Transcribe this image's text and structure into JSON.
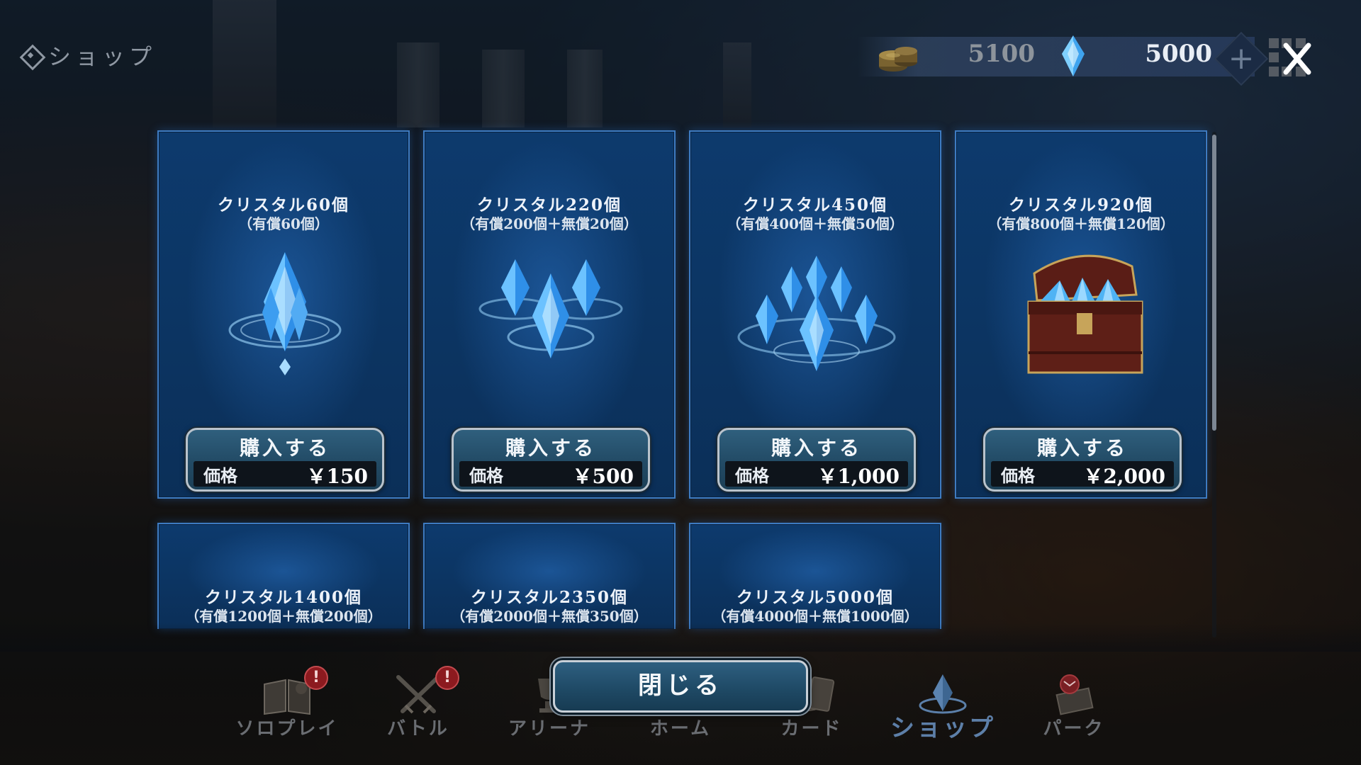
{
  "header": {
    "screen_title": "ショップ",
    "coins": "5100",
    "crystals": "5000",
    "plus_glyph": "+"
  },
  "products": [
    {
      "title": "クリスタル60個",
      "detail": "（有償60個）",
      "buy_label": "購入する",
      "price_label": "価格",
      "price": "￥150",
      "art": "single-crystal"
    },
    {
      "title": "クリスタル220個",
      "detail": "（有償200個＋無償20個）",
      "buy_label": "購入する",
      "price_label": "価格",
      "price": "￥500",
      "art": "three-crystals"
    },
    {
      "title": "クリスタル450個",
      "detail": "（有償400個＋無償50個）",
      "buy_label": "購入する",
      "price_label": "価格",
      "price": "￥1,000",
      "art": "six-crystals"
    },
    {
      "title": "クリスタル920個",
      "detail": "（有償800個＋無償120個）",
      "buy_label": "購入する",
      "price_label": "価格",
      "price": "￥2,000",
      "art": "treasure-chest"
    },
    {
      "title": "クリスタル1400個",
      "detail": "（有償1200個＋無償200個）"
    },
    {
      "title": "クリスタル2350個",
      "detail": "（有償2000個＋無償350個）"
    },
    {
      "title": "クリスタル5000個",
      "detail": "（有償4000個＋無償1000個）"
    }
  ],
  "close_button": "閉じる",
  "nav": [
    {
      "label": "ソロプレイ",
      "icon": "book-icon",
      "badge": "!"
    },
    {
      "label": "バトル",
      "icon": "crossed-swords-icon",
      "badge": "!"
    },
    {
      "label": "アリーナ",
      "icon": "trophy-icon"
    },
    {
      "label": "ホーム",
      "icon": "home-icon"
    },
    {
      "label": "カード",
      "icon": "cards-icon"
    },
    {
      "label": "ショップ",
      "icon": "shop-crystal-icon",
      "active": true
    },
    {
      "label": "パーク",
      "icon": "park-mail-icon"
    }
  ],
  "colors": {
    "card_bg": "#0c3563",
    "card_border": "#3d7bc2",
    "button_bg": "#234c67",
    "active_nav": "#5d7fa8",
    "badge": "#8c1a1f"
  }
}
